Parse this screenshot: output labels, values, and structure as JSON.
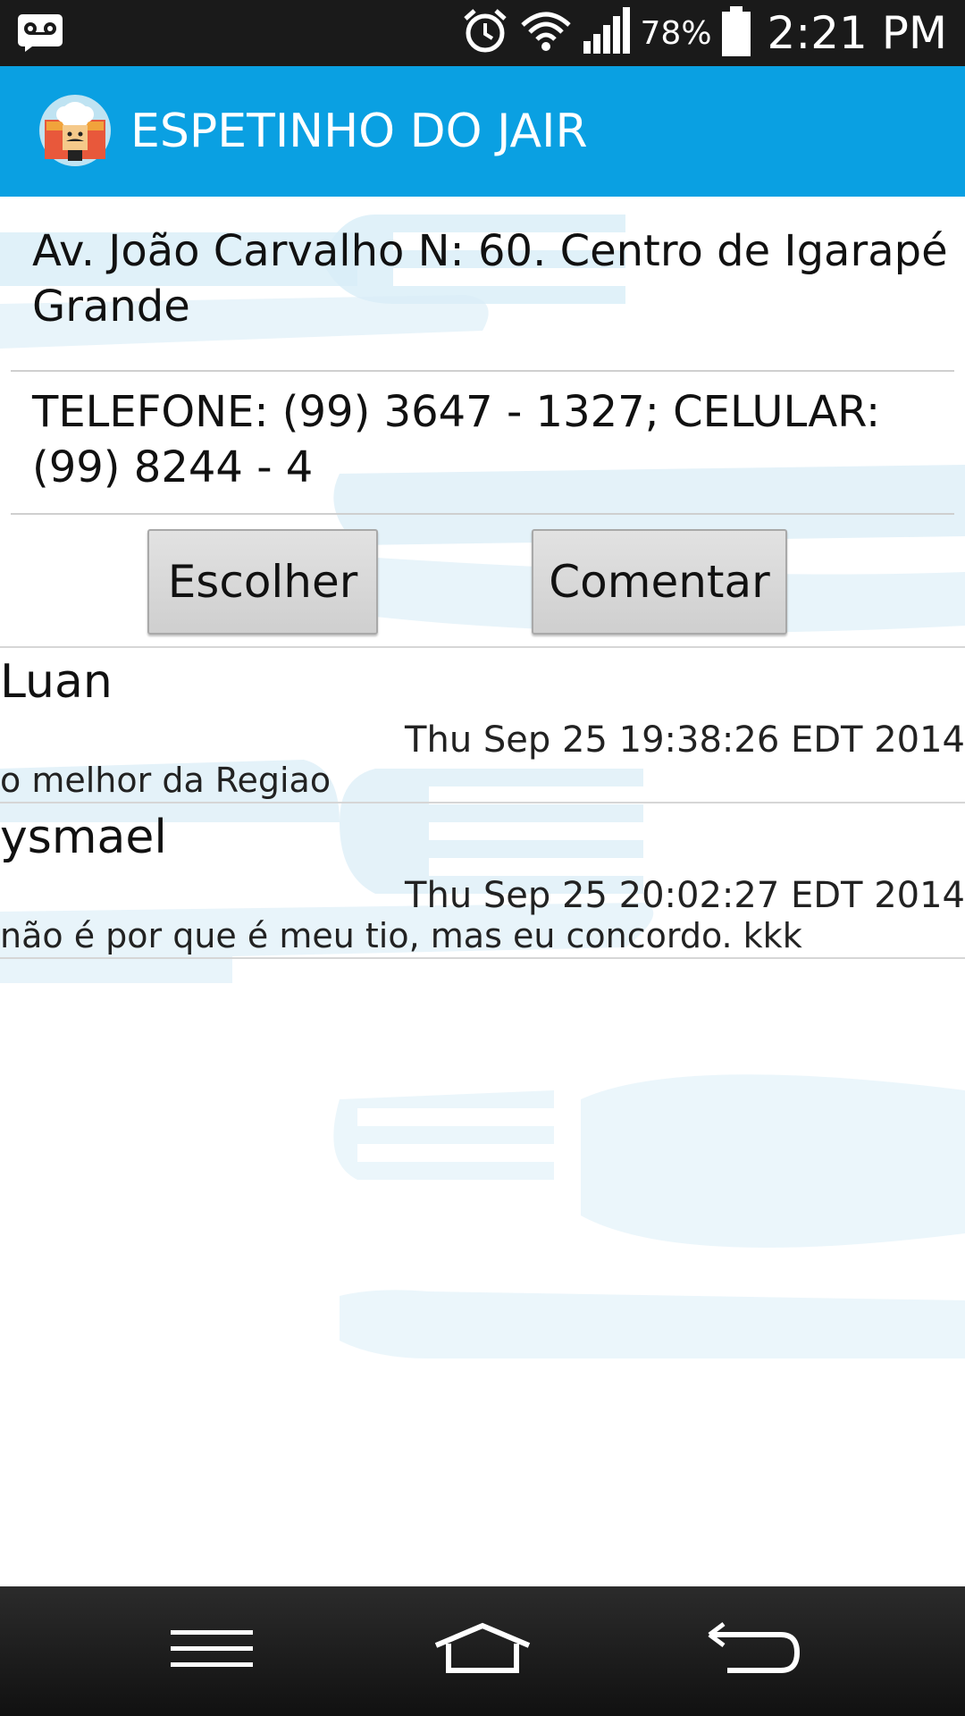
{
  "status_bar": {
    "battery_percent": "78%",
    "time": "2:21 PM",
    "icons": [
      "voicemail-icon",
      "alarm-icon",
      "wifi-icon",
      "signal-icon",
      "battery-icon"
    ]
  },
  "app": {
    "title": "ESPETINHO DO JAIR",
    "icon": "chef-logo-icon",
    "accent_color": "#0aa0e2"
  },
  "info": {
    "address": "Av. João Carvalho N: 60. Centro de Igarapé Grande",
    "phone": "TELEFONE: (99) 3647 - 1327; CELULAR: (99) 8244 - 4"
  },
  "buttons": {
    "choose_label": "Escolher",
    "comment_label": "Comentar"
  },
  "comments": [
    {
      "author": "Luan",
      "date": "Thu Sep 25 19:38:26 EDT 2014",
      "text": "o melhor da Regiao"
    },
    {
      "author": "ysmael",
      "date": "Thu Sep 25 20:02:27 EDT 2014",
      "text": "não é por que é meu tio, mas eu concordo. kkk"
    }
  ],
  "nav_bar": {
    "icons": [
      "menu-icon",
      "home-icon",
      "back-icon"
    ]
  }
}
